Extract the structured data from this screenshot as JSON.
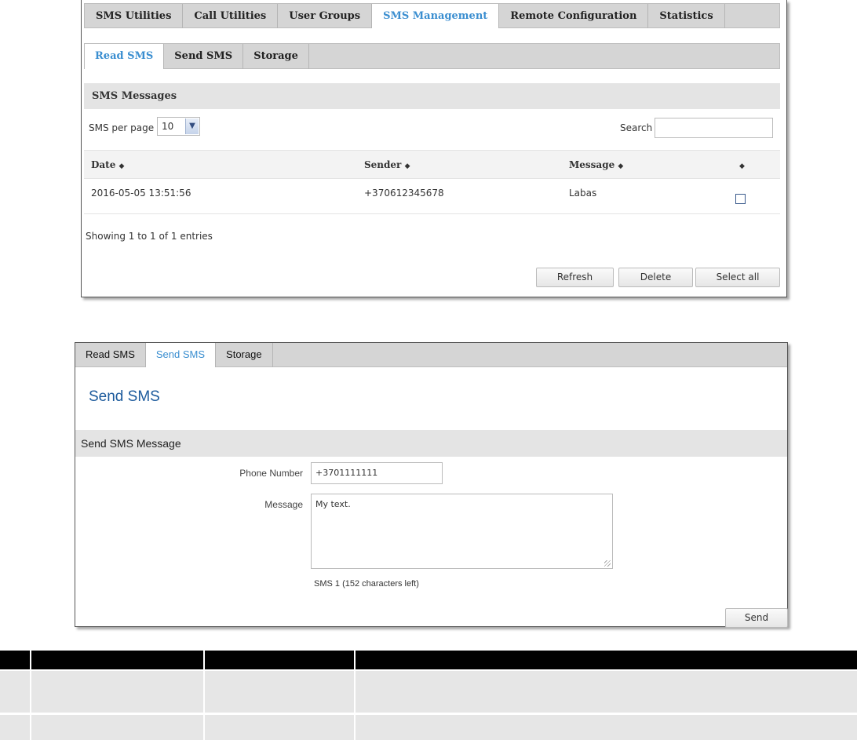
{
  "top_tabs": [
    "SMS Utilities",
    "Call Utilities",
    "User Groups",
    "SMS Management",
    "Remote Configuration",
    "Statistics"
  ],
  "top_tab_active": "SMS Management",
  "read_panel": {
    "sub_tabs": [
      "Read SMS",
      "Send SMS",
      "Storage"
    ],
    "active_sub_tab": "Read SMS",
    "section_title": "SMS Messages",
    "per_page_label": "SMS per page",
    "per_page_value": "10",
    "search_label": "Search",
    "search_value": "",
    "columns": [
      "Date",
      "Sender",
      "Message",
      ""
    ],
    "sort_icon": "sort-diamond-icon",
    "rows": [
      {
        "date": "2016-05-05 13:51:56",
        "sender": "+370612345678",
        "message": "Labas",
        "checked": false
      }
    ],
    "entries_text": "Showing 1 to 1 of 1 entries",
    "buttons": {
      "refresh": "Refresh",
      "delete": "Delete",
      "select_all": "Select all"
    }
  },
  "send_panel": {
    "tabs": [
      "Read SMS",
      "Send SMS",
      "Storage"
    ],
    "active_tab": "Send SMS",
    "title": "Send SMS",
    "section_title": "Send SMS Message",
    "phone_label": "Phone Number",
    "phone_value": "+3701111111",
    "message_label": "Message",
    "message_value": "My text.",
    "counter_text": "SMS 1 (152 characters left)",
    "send_button": "Send"
  },
  "colors": {
    "accent": "#3a8ed0",
    "title_blue": "#1c5a9c",
    "tab_bar": "#d5d5d5",
    "section_bar": "#e4e4e4"
  }
}
